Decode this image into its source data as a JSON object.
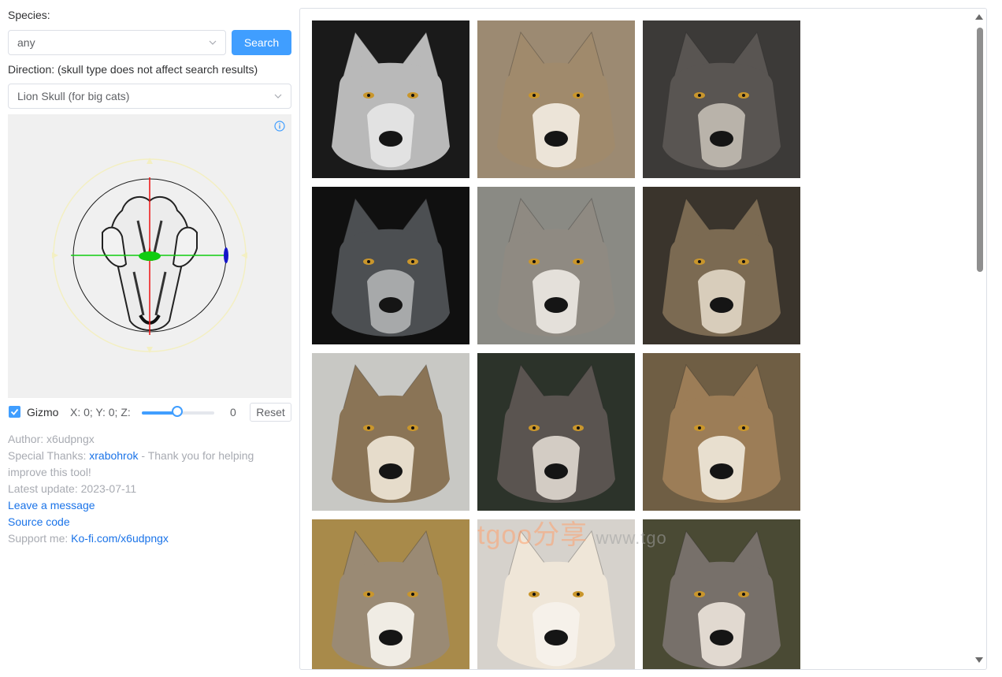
{
  "species": {
    "label": "Species:",
    "value": "any",
    "search_label": "Search"
  },
  "direction": {
    "label": "Direction: (skull type does not affect search results)",
    "value": "Lion Skull (for big cats)"
  },
  "gizmo": {
    "label": "Gizmo",
    "checked": true,
    "coords_label": "X: 0; Y: 0; Z:",
    "slider_value": "0",
    "reset_label": "Reset"
  },
  "credits": {
    "author": "Author: x6udpngx",
    "thanks_prefix": "Special Thanks:",
    "thanks_link": "xrabohrok",
    "thanks_suffix": " - Thank you for helping improve this tool!",
    "latest_update": "Latest update: 2023-07-11",
    "leave_message": "Leave a message",
    "source_code": "Source code",
    "support_prefix": "Support me:",
    "support_link": "Ko-fi.com/x6udpngx"
  },
  "watermark": {
    "brand": "tgoo分享",
    "site": "www.tgo"
  },
  "results": [
    {
      "name": "wolf-photo-1",
      "bg": "#1a1a1a",
      "fur": "#b9b9b9",
      "muzzle": "#e2e2e2"
    },
    {
      "name": "wolf-photo-2",
      "bg": "#9c8a72",
      "fur": "#a08a6c",
      "muzzle": "#ece4d8"
    },
    {
      "name": "wolf-photo-3",
      "bg": "#3c3a38",
      "fur": "#595552",
      "muzzle": "#b9b3aa"
    },
    {
      "name": "wolf-photo-4",
      "bg": "#101010",
      "fur": "#4c4f52",
      "muzzle": "#a7a9aa"
    },
    {
      "name": "wolf-photo-5",
      "bg": "#8a8a84",
      "fur": "#8f8a82",
      "muzzle": "#e4e0da"
    },
    {
      "name": "wolf-photo-6",
      "bg": "#3a342c",
      "fur": "#7b6a52",
      "muzzle": "#d8cdbb"
    },
    {
      "name": "wolf-photo-7",
      "bg": "#c8c8c4",
      "fur": "#8a7456",
      "muzzle": "#e6dccb"
    },
    {
      "name": "wolf-photo-8",
      "bg": "#2c332a",
      "fur": "#5a5450",
      "muzzle": "#d3ccc4"
    },
    {
      "name": "wolf-photo-9",
      "bg": "#6f5e44",
      "fur": "#9c7d57",
      "muzzle": "#e8dfcf"
    },
    {
      "name": "wolf-photo-10",
      "bg": "#a88a4a",
      "fur": "#9a8a74",
      "muzzle": "#f0ece4"
    },
    {
      "name": "wolf-photo-11",
      "bg": "#d6d2cc",
      "fur": "#efe6d8",
      "muzzle": "#f6f1ea"
    },
    {
      "name": "wolf-photo-12",
      "bg": "#4a4a34",
      "fur": "#77706a",
      "muzzle": "#e1d9d0"
    }
  ]
}
